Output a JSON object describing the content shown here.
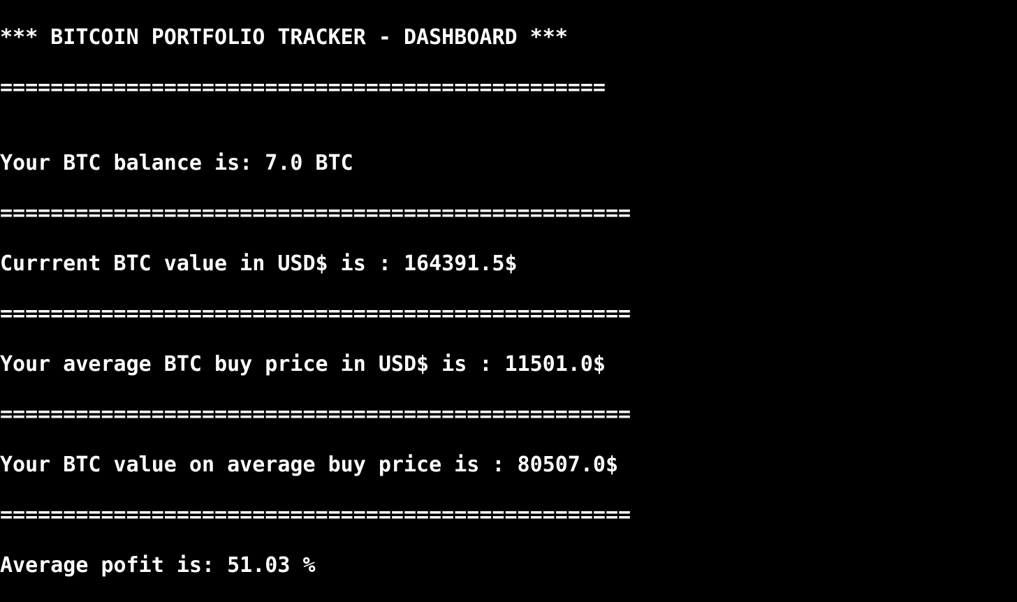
{
  "terminal": {
    "title": "*** BITCOIN PORTFOLIO TRACKER - DASHBOARD ***",
    "separator_short": "================================================",
    "balance_line": "Your BTC balance is: 7.0 BTC",
    "separator_1": "==================================================",
    "current_value_line": "Currrent BTC value in USD$ is : 164391.5$",
    "separator_2": "==================================================",
    "avg_buy_price_line": "Your average BTC buy price in USD$ is : 11501.0$",
    "separator_3": "==================================================",
    "value_on_avg_line": "Your BTC value on average buy price is : 80507.0$",
    "separator_4": "==================================================",
    "profit_line": "Average pofit is: 51.03 %"
  },
  "colors": {
    "background": "#000000",
    "text": "#ffffff"
  }
}
